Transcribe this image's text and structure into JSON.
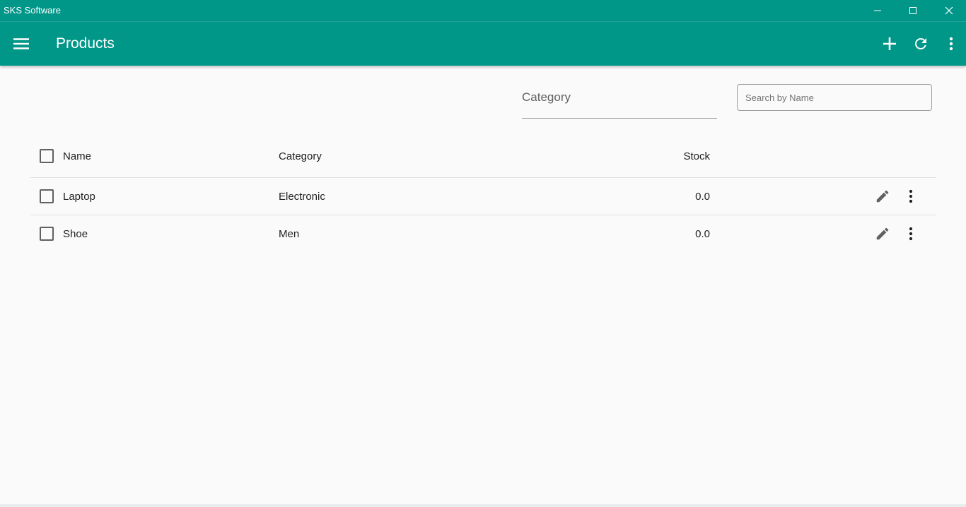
{
  "window": {
    "title": "SKS Software",
    "controls": [
      "minimize-icon",
      "maximize-icon",
      "close-icon"
    ]
  },
  "appbar": {
    "title": "Products",
    "color": "#009688",
    "icons": [
      "menu-icon",
      "add-icon",
      "refresh-icon",
      "more-vert-icon"
    ]
  },
  "filters": {
    "category_label": "Category",
    "search_placeholder": "Search by Name",
    "search_value": ""
  },
  "table": {
    "columns": [
      "Name",
      "Category",
      "Stock"
    ],
    "rows": [
      {
        "name": "Laptop",
        "category": "Electronic",
        "stock": "0.0"
      },
      {
        "name": "Shoe",
        "category": "Men",
        "stock": "0.0"
      }
    ]
  }
}
